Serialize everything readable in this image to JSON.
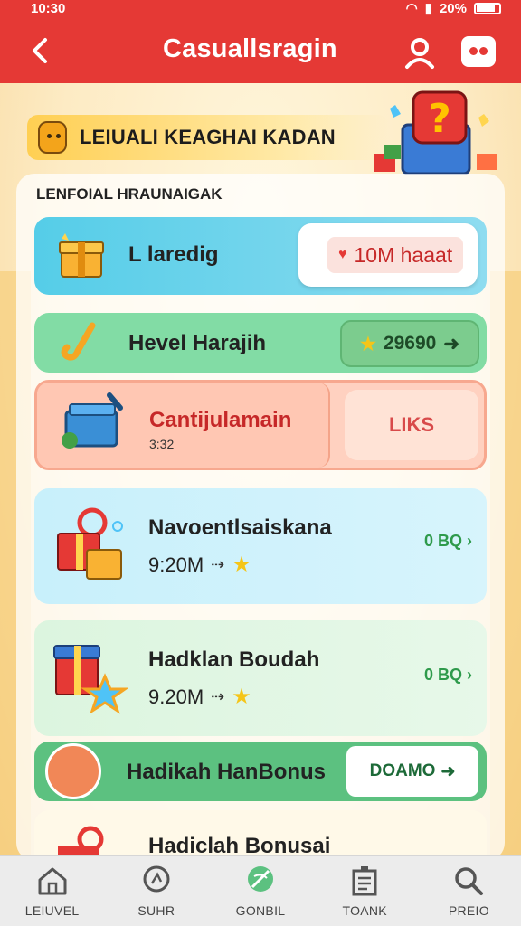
{
  "status_bar": {
    "time": "10:30",
    "battery": "20%"
  },
  "app_bar": {
    "back_icon": "back-arrow-icon",
    "title": "Casuallsragin",
    "profile_icon": "person-icon",
    "game_icon": "gamepad-icon"
  },
  "promo": {
    "text": "LEIUALI KEAGHAI KADAN"
  },
  "section_title": "LENFOIAL HRAUNAIGAK",
  "cards": [
    {
      "name": "L laredig",
      "pill_text": "10M haaat"
    },
    {
      "name": "Hevel Harajih",
      "pill_value": "29690"
    },
    {
      "name": "Cantijulamain",
      "sub": "3:32",
      "pill_text": "LIKS"
    },
    {
      "name": "Navoentlsaiskana",
      "meta": "9:20M",
      "link": "0 BQ"
    },
    {
      "name": "Hadklan Boudah",
      "meta": "9.20M",
      "link": "0 BQ"
    },
    {
      "name": "Hadikah HanBonus",
      "pill_text": "DOAMO"
    },
    {
      "name": "Hadiclah Bonusai"
    }
  ],
  "bottom_nav": [
    {
      "label": "LEIUVEL",
      "icon": "home-icon"
    },
    {
      "label": "SUHR",
      "icon": "search-icon"
    },
    {
      "label": "GONBIL",
      "icon": "leaf-icon"
    },
    {
      "label": "TOANK",
      "icon": "ticket-icon"
    },
    {
      "label": "PREIO",
      "icon": "magnifier-icon"
    }
  ],
  "colors": {
    "app_bar": "#e53935",
    "accent_green": "#5cc180",
    "accent_blue": "#55cde8"
  }
}
